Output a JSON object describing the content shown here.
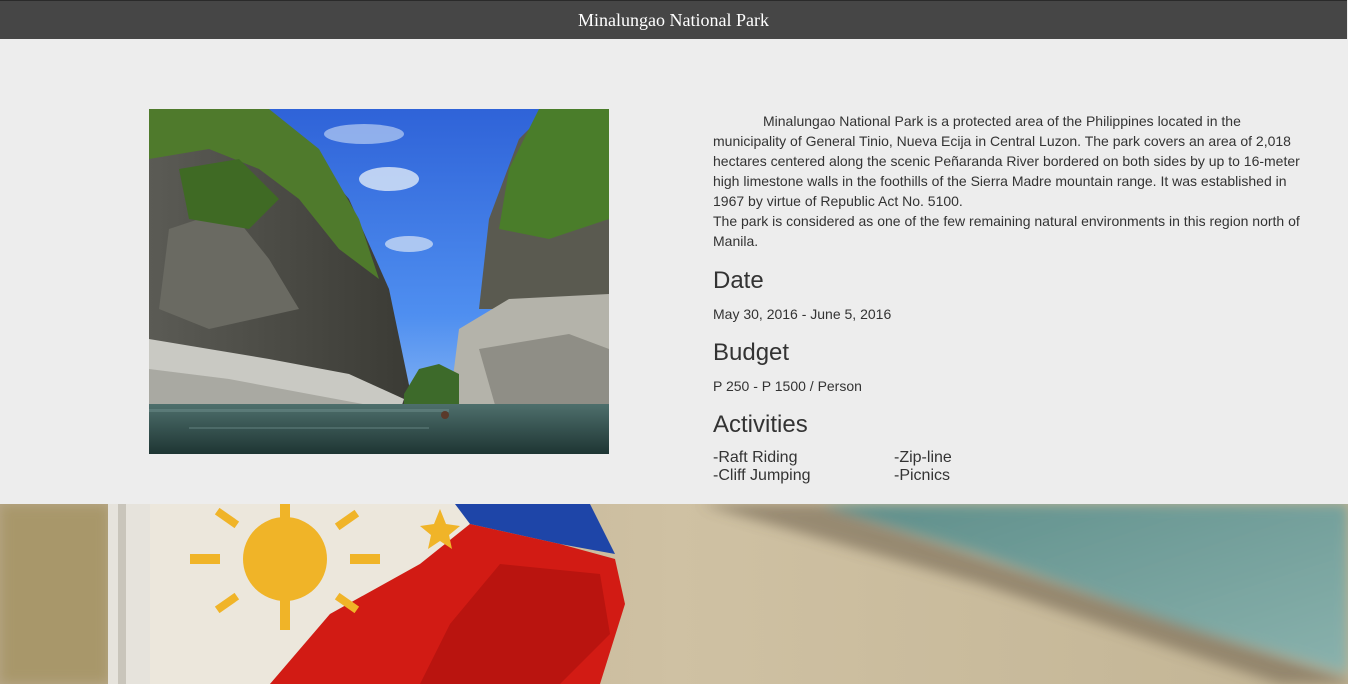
{
  "header": {
    "title": "Minalungao National Park"
  },
  "park": {
    "description_1": "Minalungao National Park is a protected area of the Philippines located in the municipality of General Tinio, Nueva Ecija in Central Luzon. The park covers an area of 2,018 hectares centered along the scenic Peñaranda River bordered on both sides by up to 16-meter high limestone walls in the foothills of the Sierra Madre mountain range. It was established in 1967 by virtue of Republic Act No. 5100.",
    "description_2": "The park is considered as one of the few remaining natural environments in this region north of Manila.",
    "date_heading": "Date",
    "date_value": "May 30, 2016 - June 5, 2016",
    "budget_heading": "Budget",
    "budget_value": "P 250 - P 1500 / Person",
    "activities_heading": "Activities",
    "activities": [
      "-Raft Riding",
      "-Zip-line",
      "-Cliff Jumping",
      "-Picnics"
    ]
  },
  "colors": {
    "header_bg": "#464646",
    "page_bg": "#ededed",
    "text": "#333333"
  }
}
